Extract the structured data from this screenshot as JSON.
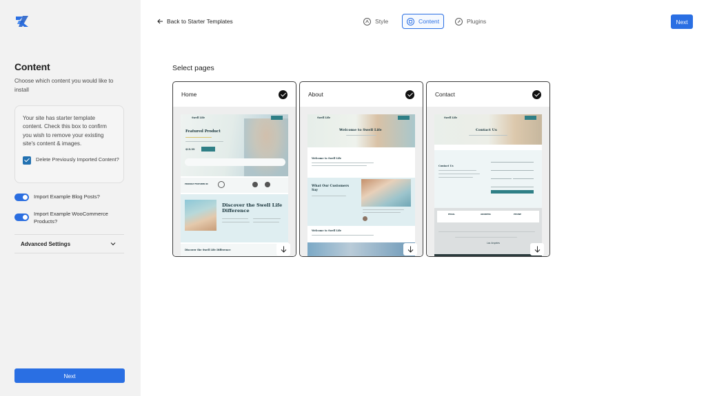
{
  "sidebar": {
    "title": "Content",
    "description": "Choose which content you would like to install",
    "notice": "Your site has starter template content. Check this box to confirm you wish to remove your existing site's content & images.",
    "delete_label": "Delete Previously Imported Content?",
    "toggle_blog": "Import Example Blog Posts?",
    "toggle_woo": "Import Example WooCommerce Products?",
    "advanced": "Advanced Settings",
    "next": "Next"
  },
  "topbar": {
    "back": "Back to Starter Templates",
    "steps": [
      "Style",
      "Content",
      "Plugins"
    ],
    "next": "Next"
  },
  "main": {
    "title": "Select pages",
    "pages": [
      {
        "label": "Home",
        "selected": true
      },
      {
        "label": "About",
        "selected": true
      },
      {
        "label": "Contact",
        "selected": true
      }
    ]
  },
  "preview": {
    "brand": "Swell Life",
    "home_heading": "Featured Product",
    "home_price": "$19.99",
    "home_featured": "PROUDLY FEATURED IN",
    "home_discover": "Discover the Swell Life Difference",
    "home_discover_2": "Discover the Swell Life Difference",
    "about_heading": "Welcome to Swell Life",
    "about_sub": "Welcome to Swell Life",
    "about_customers": "What Our Customers Say",
    "about_welcome2": "Welcome to Swell Life",
    "contact_heading": "Contact Us",
    "contact_sub": "Contact Us",
    "contact_email": "EMAIL",
    "contact_address": "ADDRESS",
    "contact_phone": "PHONE",
    "contact_city": "Los Angeles"
  },
  "colors": {
    "accent": "#2a6fe3",
    "sidebar_bg": "#f2f2f2",
    "teal": "#2f7f86"
  }
}
